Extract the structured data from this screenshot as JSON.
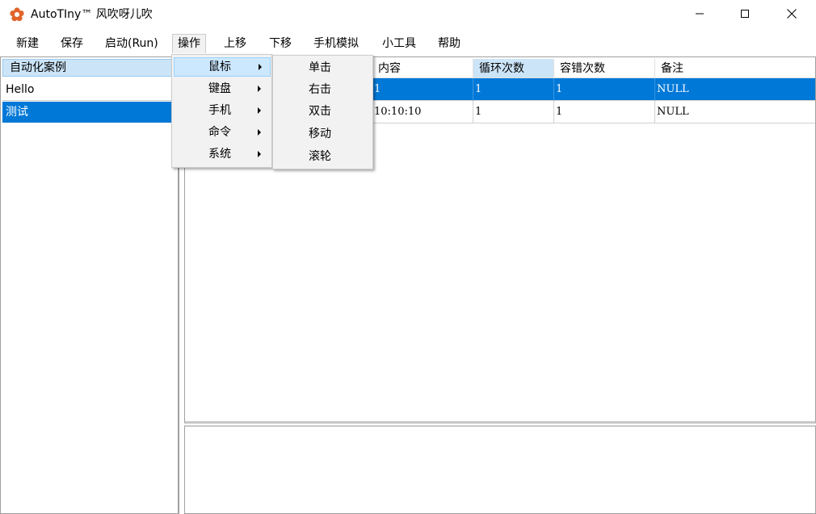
{
  "window": {
    "title": "AutoTIny™ 风吹呀儿吹",
    "accent": "#0078d7",
    "icon": "flower-icon",
    "controls": [
      "minimize-icon",
      "maximize-icon",
      "close-icon"
    ]
  },
  "menubar": {
    "items": [
      "新建",
      "保存",
      "启动(Run)",
      "操作",
      "上移",
      "下移",
      "手机模拟",
      "小工具",
      "帮助"
    ]
  },
  "left_panel": {
    "header": "自动化案例",
    "items": [
      "Hello",
      "测试"
    ]
  },
  "grid": {
    "headers": [
      "内容",
      "循环次数",
      "容错次数",
      "备注"
    ],
    "rows": [
      [
        "1",
        "1",
        "1",
        "NULL"
      ],
      [
        "10:10:10",
        "1",
        "1",
        "NULL"
      ]
    ]
  },
  "operate_menu": {
    "items": [
      "鼠标",
      "键盘",
      "手机",
      "命令",
      "系统"
    ]
  },
  "mouse_submenu": {
    "items": [
      "单击",
      "右击",
      "双击",
      "移动",
      "滚轮"
    ]
  }
}
